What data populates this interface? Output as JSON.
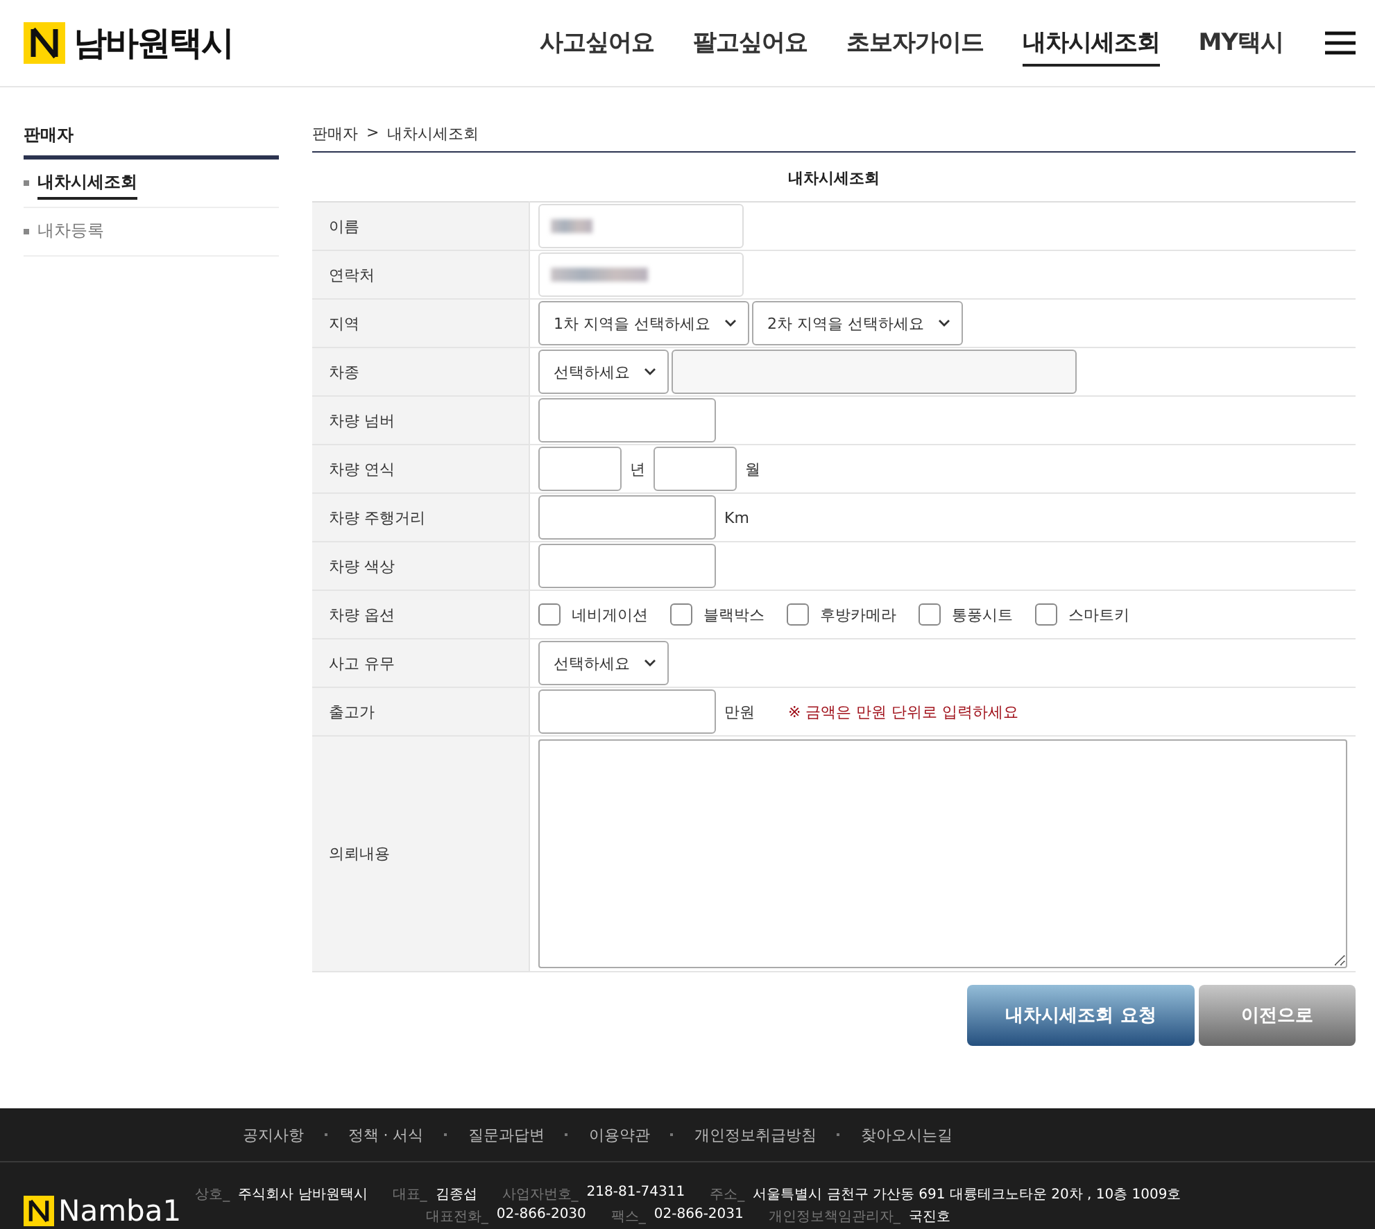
{
  "header": {
    "logo": "남바원택시",
    "nav": [
      {
        "label": "사고싶어요",
        "selected": false
      },
      {
        "label": "팔고싶어요",
        "selected": false
      },
      {
        "label": "초보자가이드",
        "selected": false
      },
      {
        "label": "내차시세조회",
        "selected": true
      },
      {
        "label": "MY택시",
        "selected": false
      }
    ]
  },
  "sidebar": {
    "title": "판매자",
    "items": [
      {
        "label": "내차시세조회",
        "selected": true
      },
      {
        "label": "내차등록",
        "selected": false
      }
    ]
  },
  "breadcrumb": {
    "items": [
      "판매자",
      "내차시세조회"
    ],
    "separator": ">"
  },
  "form": {
    "title": "내차시세조회",
    "rows": [
      {
        "label": "이름",
        "kind": "redacted"
      },
      {
        "label": "연락처",
        "kind": "redacted"
      },
      {
        "label": "지역",
        "kind": "selects",
        "selects": [
          "1차 지역을 선택하세요",
          "2차 지역을 선택하세요"
        ]
      },
      {
        "label": "차종",
        "kind": "select_input",
        "selects": [
          "선택하세요"
        ]
      },
      {
        "label": "차량 넘버",
        "kind": "input"
      },
      {
        "label": "차량 연식",
        "kind": "year_month",
        "units": [
          "년",
          "월"
        ]
      },
      {
        "label": "차량 주행거리",
        "kind": "input",
        "unit": "Km"
      },
      {
        "label": "차량 색상",
        "kind": "input"
      },
      {
        "label": "차량 옵션",
        "kind": "checkboxes",
        "options": [
          {
            "label": "네비게이션",
            "checked": false
          },
          {
            "label": "블랙박스",
            "checked": false
          },
          {
            "label": "후방카메라",
            "checked": false
          },
          {
            "label": "통풍시트",
            "checked": false
          },
          {
            "label": "스마트키",
            "checked": false
          }
        ]
      },
      {
        "label": "사고 유무",
        "kind": "selects",
        "selects": [
          "선택하세요"
        ]
      },
      {
        "label": "출고가",
        "kind": "input",
        "unit": "만원",
        "note": "※ 금액은 만원 단위로 입력하세요"
      },
      {
        "label": "의뢰내용",
        "kind": "textarea"
      }
    ],
    "buttons": [
      {
        "label": "내차시세조회 요청",
        "kind": "primary"
      },
      {
        "label": "이전으로",
        "kind": "secondary"
      }
    ]
  },
  "footer": {
    "links": [
      "공지사항",
      "정책 · 서식",
      "질문과답변",
      "이용약관",
      "개인정보취급방침",
      "찾아오시는길"
    ],
    "logo": "Namba1",
    "info": [
      [
        {
          "key": "상호_",
          "value": "주식회사 남바원택시"
        },
        {
          "key": "대표_",
          "value": "김종섭"
        },
        {
          "key": "사업자번호_",
          "value": "218-81-74311"
        },
        {
          "key": "주소_",
          "value": "서울특별시 금천구 가산동 691 대륭테크노타운 20차 , 10층 1009호"
        }
      ],
      [
        {
          "key": "대표전화_",
          "value": "02-866-2030"
        },
        {
          "key": "팩스_",
          "value": "02-866-2031"
        },
        {
          "key": "개인정보책임관리자_",
          "value": "국진호"
        }
      ]
    ]
  }
}
